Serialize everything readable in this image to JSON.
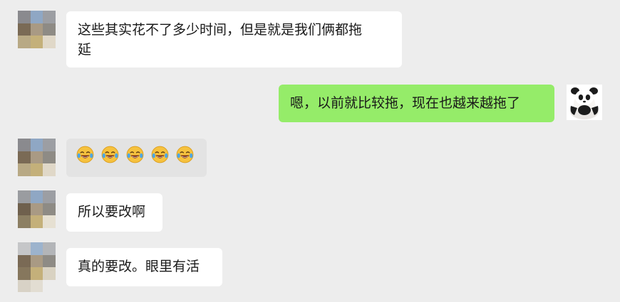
{
  "messages": [
    {
      "side": "in",
      "text": "这些其实花不了多少时间，但是就是我们俩都拖\n延"
    },
    {
      "side": "out",
      "text": "嗯，以前就比较拖，现在也越来越拖了"
    },
    {
      "side": "in",
      "type": "emoji",
      "emoji_name": "tears-of-joy-icon",
      "emoji_count": 5
    },
    {
      "side": "in",
      "text": "所以要改啊"
    },
    {
      "side": "in",
      "text": "真的要改。眼里有活"
    }
  ],
  "colors": {
    "background": "#ededed",
    "incoming_bubble": "#ffffff",
    "outgoing_bubble": "#95ec69",
    "emoji_bubble": "#e3e3e3"
  },
  "avatars": {
    "contact": "blurred-avatar",
    "self": "panda-avatar"
  }
}
